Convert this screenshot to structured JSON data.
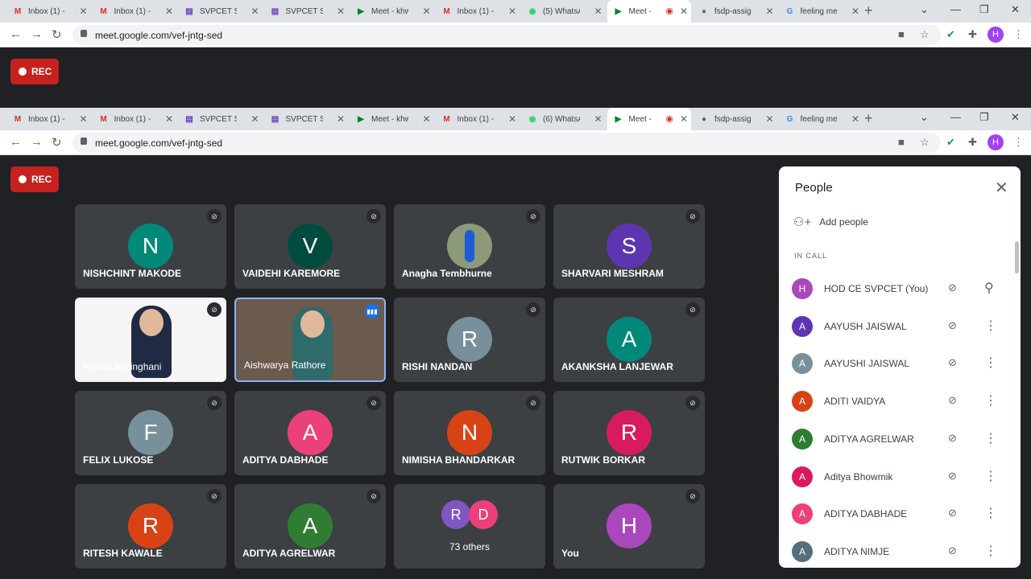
{
  "tabs": [
    {
      "favicon": "M",
      "favicolor": "#d93025",
      "title": "Inbox (1) - h"
    },
    {
      "favicon": "M",
      "favicolor": "#d93025",
      "title": "Inbox (1) - a"
    },
    {
      "favicon": "▤",
      "favicolor": "#673ab7",
      "title": "SVPCET Stu"
    },
    {
      "favicon": "▤",
      "favicolor": "#673ab7",
      "title": "SVPCET Stu"
    },
    {
      "favicon": "▶",
      "favicolor": "#00832d",
      "title": "Meet - khw"
    },
    {
      "favicon": "M",
      "favicolor": "#d93025",
      "title": "Inbox (1) - s"
    },
    {
      "favicon": "◉",
      "favicolor": "#25d366",
      "title": "(5) WhatsAp"
    },
    {
      "favicon": "▶",
      "favicolor": "#00832d",
      "title": "Meet -"
    },
    {
      "favicon": "●",
      "favicolor": "#5f6368",
      "title": "fsdp-assign"
    },
    {
      "favicon": "G",
      "favicolor": "#4285f4",
      "title": "feeling mea"
    }
  ],
  "tabs2": [
    {
      "favicon": "M",
      "favicolor": "#d93025",
      "title": "Inbox (1) - h"
    },
    {
      "favicon": "M",
      "favicolor": "#d93025",
      "title": "Inbox (1) - a"
    },
    {
      "favicon": "▤",
      "favicolor": "#673ab7",
      "title": "SVPCET Stu"
    },
    {
      "favicon": "▤",
      "favicolor": "#673ab7",
      "title": "SVPCET Stu"
    },
    {
      "favicon": "▶",
      "favicolor": "#00832d",
      "title": "Meet - khw"
    },
    {
      "favicon": "M",
      "favicolor": "#d93025",
      "title": "Inbox (1) - s"
    },
    {
      "favicon": "◉",
      "favicolor": "#25d366",
      "title": "(6) WhatsAp"
    },
    {
      "favicon": "▶",
      "favicolor": "#00832d",
      "title": "Meet -"
    },
    {
      "favicon": "●",
      "favicolor": "#5f6368",
      "title": "fsdp-assign"
    },
    {
      "favicon": "G",
      "favicolor": "#4285f4",
      "title": "feeling mea"
    }
  ],
  "url": "meet.google.com/vef-jntg-sed",
  "profile_initial": "H",
  "rec_label": "REC",
  "tiles": [
    {
      "name": "NISHCHINT MAKODE",
      "initial": "N",
      "color": "#00897b"
    },
    {
      "name": "VAIDEHI KAREMORE",
      "initial": "V",
      "color": "#004d40"
    },
    {
      "name": "Anagha Tembhurne",
      "initial": "",
      "color": "#8d9a7a",
      "photo": true
    },
    {
      "name": "SHARVARI MESHRAM",
      "initial": "S",
      "color": "#5e35b1"
    },
    {
      "name": "Komal Jaisinghani",
      "initial": "",
      "color": "#f5f5f5",
      "video": true
    },
    {
      "name": "Aishwarya Rathore",
      "initial": "",
      "color": "#6b5a4e",
      "video": true,
      "active": true
    },
    {
      "name": "RISHI NANDAN",
      "initial": "R",
      "color": "#78909c"
    },
    {
      "name": "AKANKSHA LANJEWAR",
      "initial": "A",
      "color": "#00897b"
    },
    {
      "name": "FELIX LUKOSE",
      "initial": "F",
      "color": "#78909c"
    },
    {
      "name": "ADITYA DABHADE",
      "initial": "A",
      "color": "#ec407a"
    },
    {
      "name": "NIMISHA BHANDARKAR",
      "initial": "N",
      "color": "#d84315"
    },
    {
      "name": "RUTWIK BORKAR",
      "initial": "R",
      "color": "#d81b60"
    },
    {
      "name": "RITESH KAWALE",
      "initial": "R",
      "color": "#d84315"
    },
    {
      "name": "ADITYA AGRELWAR",
      "initial": "A",
      "color": "#2e7d32"
    },
    {
      "name": "73 others",
      "initial": "",
      "color": "",
      "others": true
    },
    {
      "name": "You",
      "initial": "H",
      "color": "#ab47bc"
    }
  ],
  "others": [
    {
      "initial": "R",
      "color": "#7e57c2"
    },
    {
      "initial": "D",
      "color": "#ec407a"
    }
  ],
  "panel": {
    "title": "People",
    "add_people": "Add people",
    "section": "IN CALL",
    "people": [
      {
        "name": "HOD CE SVPCET (You)",
        "initial": "H",
        "color": "#ab47bc",
        "pin": true
      },
      {
        "name": "AAYUSH JAISWAL",
        "initial": "A",
        "color": "#5e35b1"
      },
      {
        "name": "AAYUSHI JAISWAL",
        "initial": "A",
        "color": "#78909c"
      },
      {
        "name": "ADITI VAIDYA",
        "initial": "A",
        "color": "#d84315"
      },
      {
        "name": "ADITYA AGRELWAR",
        "initial": "A",
        "color": "#2e7d32"
      },
      {
        "name": "Aditya Bhowmik",
        "initial": "A",
        "color": "#d81b60"
      },
      {
        "name": "ADITYA DABHADE",
        "initial": "A",
        "color": "#ec407a"
      },
      {
        "name": "ADITYA NIMJE",
        "initial": "A",
        "color": "#546e7a"
      }
    ]
  }
}
